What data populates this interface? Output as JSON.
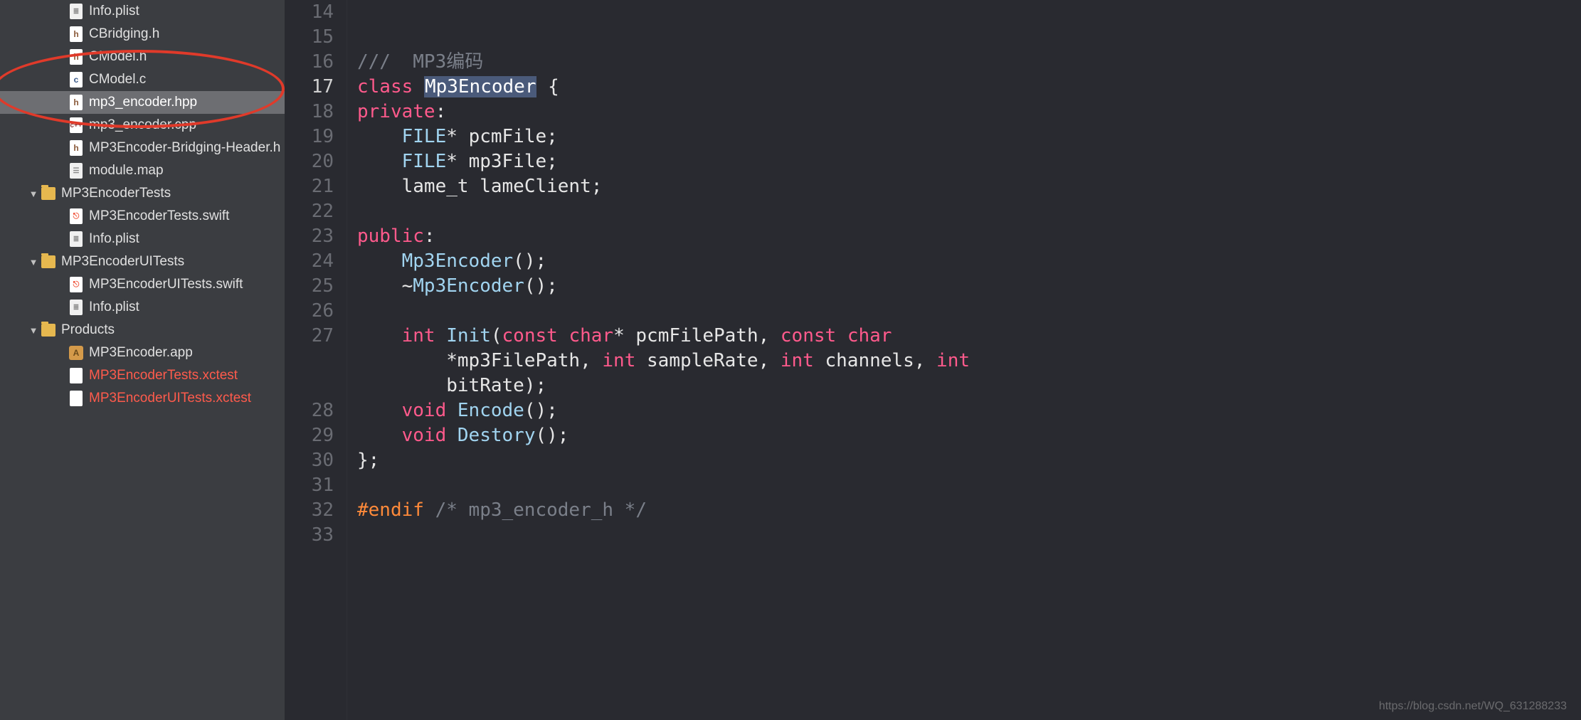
{
  "sidebar": {
    "items": [
      {
        "name": "Info.plist",
        "type": "plist",
        "depth": 2,
        "disclosure": "",
        "selected": false
      },
      {
        "name": "CBridging.h",
        "type": "h",
        "depth": 2,
        "disclosure": "",
        "selected": false
      },
      {
        "name": "CModel.h",
        "type": "h",
        "depth": 2,
        "disclosure": "",
        "selected": false
      },
      {
        "name": "CModel.c",
        "type": "c",
        "depth": 2,
        "disclosure": "",
        "selected": false
      },
      {
        "name": "mp3_encoder.hpp",
        "type": "h",
        "depth": 2,
        "disclosure": "",
        "selected": true
      },
      {
        "name": "mp3_encoder.cpp",
        "type": "cpp",
        "depth": 2,
        "disclosure": "",
        "selected": false
      },
      {
        "name": "MP3Encoder-Bridging-Header.h",
        "type": "h",
        "depth": 2,
        "disclosure": "",
        "selected": false
      },
      {
        "name": "module.map",
        "type": "module",
        "depth": 2,
        "disclosure": "",
        "selected": false
      },
      {
        "name": "MP3EncoderTests",
        "type": "folder",
        "depth": 1,
        "disclosure": "▼",
        "selected": false
      },
      {
        "name": "MP3EncoderTests.swift",
        "type": "swift",
        "depth": 2,
        "disclosure": "",
        "selected": false
      },
      {
        "name": "Info.plist",
        "type": "plist",
        "depth": 2,
        "disclosure": "",
        "selected": false
      },
      {
        "name": "MP3EncoderUITests",
        "type": "folder",
        "depth": 1,
        "disclosure": "▼",
        "selected": false
      },
      {
        "name": "MP3EncoderUITests.swift",
        "type": "swift",
        "depth": 2,
        "disclosure": "",
        "selected": false
      },
      {
        "name": "Info.plist",
        "type": "plist",
        "depth": 2,
        "disclosure": "",
        "selected": false
      },
      {
        "name": "Products",
        "type": "folder",
        "depth": 1,
        "disclosure": "▼",
        "selected": false
      },
      {
        "name": "MP3Encoder.app",
        "type": "app",
        "depth": 2,
        "disclosure": "",
        "selected": false
      },
      {
        "name": "MP3EncoderTests.xctest",
        "type": "test",
        "depth": 2,
        "disclosure": "",
        "selected": false,
        "red": true
      },
      {
        "name": "MP3EncoderUITests.xctest",
        "type": "test",
        "depth": 2,
        "disclosure": "",
        "selected": false,
        "red": true
      }
    ]
  },
  "editor": {
    "line_numbers": [
      "14",
      "15",
      "16",
      "17",
      "18",
      "19",
      "20",
      "21",
      "22",
      "23",
      "24",
      "25",
      "26",
      "27",
      "",
      "",
      "28",
      "29",
      "30",
      "31",
      "32",
      "33"
    ],
    "current_line": "17",
    "code": {
      "comment_doc": "///  MP3编码",
      "class_kw": "class",
      "class_name": "Mp3Encoder",
      "brace_open": " {",
      "private_kw": "private",
      "colon": ":",
      "file_type": "FILE",
      "star": "*",
      "pcmFile": "pcmFile",
      "mp3File": "mp3File",
      "lame_t": "lame_t",
      "lameClient": "lameClient",
      "public_kw": "public",
      "ctor": "Mp3Encoder",
      "parens": "();",
      "tilde": "~",
      "int_kw": "int",
      "init_fn": "Init",
      "const_kw": "const",
      "char_kw": "char",
      "pcmFilePath": "pcmFilePath",
      "mp3FilePath": "mp3FilePath",
      "sampleRate": "sampleRate",
      "channels": "channels",
      "bitRate": "bitRate",
      "void_kw": "void",
      "encode_fn": "Encode",
      "destory_fn": "Destory",
      "brace_close": "};",
      "endif_kw": "#endif",
      "endif_comment": "/* mp3_encoder_h */",
      "semi": ";",
      "comma": ", ",
      "open_paren": "(",
      "close_paren_semi": ");"
    }
  },
  "watermark": "https://blog.csdn.net/WQ_631288233"
}
